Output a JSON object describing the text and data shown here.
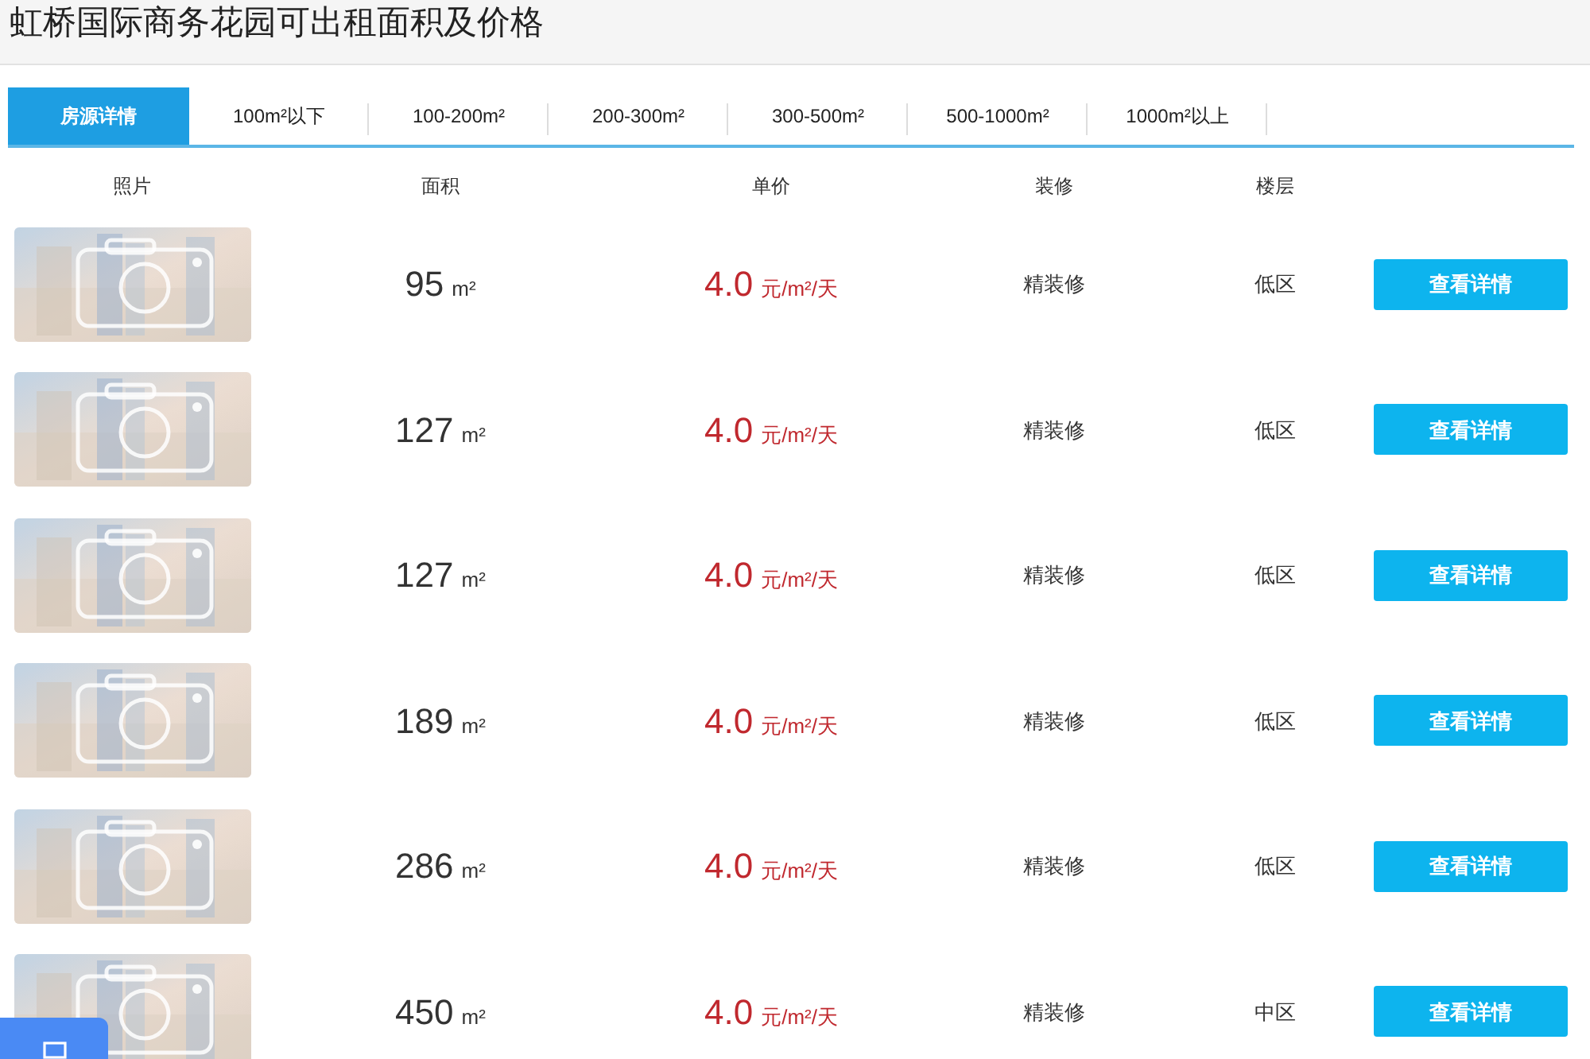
{
  "title": "虹桥国际商务花园可出租面积及价格",
  "tabs": [
    {
      "label": "房源详情",
      "selected": true
    },
    {
      "label": "100m²以下",
      "selected": false
    },
    {
      "label": "100-200m²",
      "selected": false
    },
    {
      "label": "200-300m²",
      "selected": false
    },
    {
      "label": "300-500m²",
      "selected": false
    },
    {
      "label": "500-1000m²",
      "selected": false
    },
    {
      "label": "1000m²以上",
      "selected": false
    }
  ],
  "table": {
    "columns": [
      "照片",
      "面积",
      "单价",
      "装修",
      "楼层"
    ],
    "rows": [
      {
        "area": "95",
        "area_unit": "m²",
        "price": "4.0",
        "price_unit": "元/m²/天",
        "decoration": "精装修",
        "floor": "低区",
        "button": "查看详情"
      },
      {
        "area": "127",
        "area_unit": "m²",
        "price": "4.0",
        "price_unit": "元/m²/天",
        "decoration": "精装修",
        "floor": "低区",
        "button": "查看详情"
      },
      {
        "area": "127",
        "area_unit": "m²",
        "price": "4.0",
        "price_unit": "元/m²/天",
        "decoration": "精装修",
        "floor": "低区",
        "button": "查看详情"
      },
      {
        "area": "189",
        "area_unit": "m²",
        "price": "4.0",
        "price_unit": "元/m²/天",
        "decoration": "精装修",
        "floor": "低区",
        "button": "查看详情"
      },
      {
        "area": "286",
        "area_unit": "m²",
        "price": "4.0",
        "price_unit": "元/m²/天",
        "decoration": "精装修",
        "floor": "低区",
        "button": "查看详情"
      },
      {
        "area": "450",
        "area_unit": "m²",
        "price": "4.0",
        "price_unit": "元/m²/天",
        "decoration": "精装修",
        "floor": "中区",
        "button": "查看详情"
      }
    ]
  }
}
